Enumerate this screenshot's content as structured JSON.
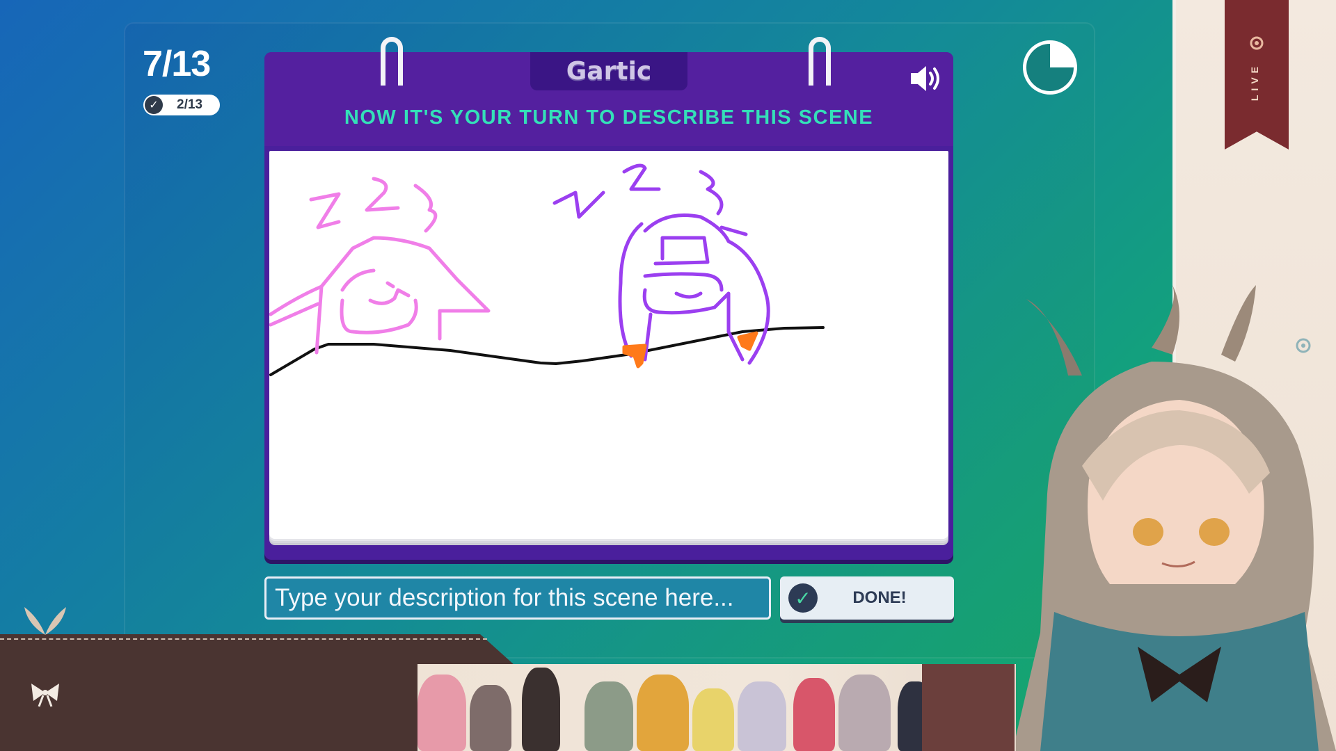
{
  "game": {
    "progress": "7/13",
    "completed": "2/13",
    "logo": "Gartic",
    "instruction": "NOW IT'S YOUR TURN TO DESCRIBE THIS SCENE",
    "input": {
      "placeholder": "Type your description for this scene here..."
    },
    "done_label": "DONE!"
  },
  "overlay": {
    "live_label": "LIVE"
  },
  "colors": {
    "notebook": "#4a1f9c",
    "instruction": "#34e0b8",
    "drawing_pink": "#f07ee8",
    "drawing_purple": "#9b3ff0",
    "drawing_orange": "#ff7a1a"
  }
}
